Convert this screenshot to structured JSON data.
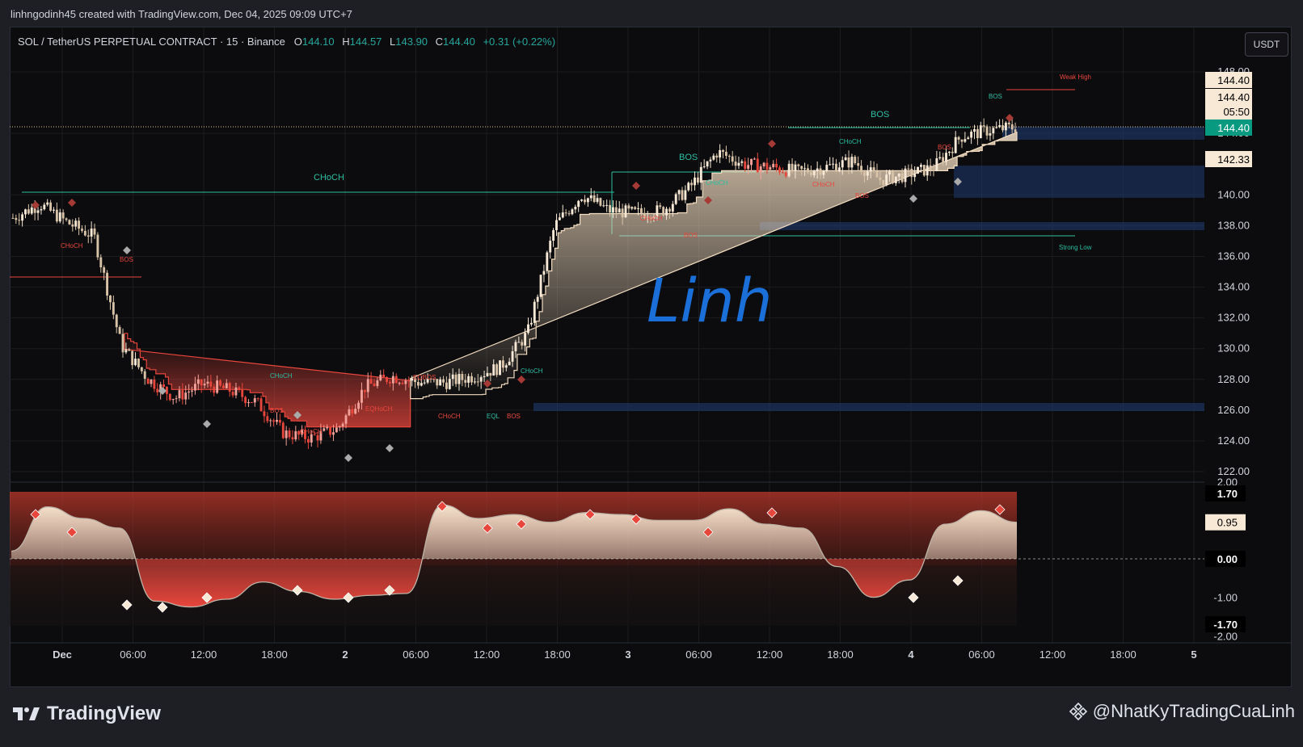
{
  "header": {
    "created_by": "linhngodinh45 created with TradingView.com, Dec 04, 2025 09:09 UTC+7"
  },
  "legend": {
    "symbol": "SOL / TetherUS PERPETUAL CONTRACT · 15 · Binance",
    "o_label": "O",
    "o": "144.10",
    "h_label": "H",
    "h": "144.57",
    "l_label": "L",
    "l": "143.90",
    "c_label": "C",
    "c": "144.40",
    "change": "+0.31 (+0.22%)"
  },
  "currency_button": "USDT",
  "price_axis": {
    "ticks": [
      "148.00",
      "144.00",
      "140.00",
      "138.00",
      "136.00",
      "134.00",
      "132.00",
      "130.00",
      "128.00",
      "126.00",
      "124.00",
      "122.00"
    ],
    "tags": [
      {
        "text": "144.40",
        "kind": "light"
      },
      {
        "text": "144.40",
        "kind": "light"
      },
      {
        "text": "05:50",
        "kind": "light"
      },
      {
        "text": "144.40",
        "kind": "green"
      },
      {
        "text": "142.33",
        "kind": "light"
      }
    ]
  },
  "osc_axis": {
    "ticks": [
      "2.00",
      "1.70",
      "0.95",
      "0.00",
      "-1.00",
      "-1.70",
      "-2.00"
    ]
  },
  "time_axis": {
    "labels": [
      "Dec",
      "06:00",
      "12:00",
      "18:00",
      "2",
      "06:00",
      "12:00",
      "18:00",
      "3",
      "06:00",
      "12:00",
      "18:00",
      "4",
      "06:00",
      "12:00",
      "18:00",
      "5"
    ]
  },
  "annotations": {
    "choch_big": "CHoCH",
    "bos_labels": [
      "BOS",
      "BOS"
    ],
    "choch": "CHoCH",
    "bos": "BOS",
    "eqbos": "EQBOS",
    "eqh_choch": "EQHoCH",
    "eql": "EQL",
    "weak_high": "Weak High",
    "strong_low": "Strong Low",
    "signature": "Linh"
  },
  "chart_data": {
    "type": "line",
    "title": "",
    "xlabel": "",
    "ylabel": "",
    "ylim": [
      122,
      148
    ],
    "x": [
      "Dec 1 00:00",
      "Dec 1 02:00",
      "Dec 1 04:00",
      "Dec 1 06:00",
      "Dec 1 08:00",
      "Dec 1 10:00",
      "Dec 1 12:00",
      "Dec 1 14:00",
      "Dec 1 16:00",
      "Dec 1 18:00",
      "Dec 1 20:00",
      "Dec 1 22:00",
      "Dec 2 00:00",
      "Dec 2 02:00",
      "Dec 2 04:00",
      "Dec 2 06:00",
      "Dec 2 08:00",
      "Dec 2 10:00",
      "Dec 2 12:00",
      "Dec 2 14:00",
      "Dec 2 16:00",
      "Dec 2 18:00",
      "Dec 2 20:00",
      "Dec 2 22:00",
      "Dec 3 00:00",
      "Dec 3 02:00",
      "Dec 3 04:00",
      "Dec 3 06:00",
      "Dec 3 08:00",
      "Dec 3 10:00",
      "Dec 3 12:00",
      "Dec 3 14:00",
      "Dec 3 16:00",
      "Dec 3 18:00",
      "Dec 3 20:00",
      "Dec 3 22:00",
      "Dec 4 00:00",
      "Dec 4 02:00",
      "Dec 4 04:00",
      "Dec 4 06:00",
      "Dec 4 08:00"
    ],
    "series": [
      {
        "name": "SOL",
        "values": [
          138.5,
          139.4,
          138.2,
          137.3,
          130.2,
          128.0,
          126.8,
          127.7,
          127.3,
          126.5,
          124.5,
          124.2,
          124.8,
          127.5,
          128.2,
          127.8,
          127.8,
          128.2,
          128.8,
          131.0,
          138.0,
          140.0,
          139.0,
          138.8,
          139.0,
          140.5,
          142.8,
          142.0,
          141.8,
          141.5,
          141.8,
          142.2,
          141.0,
          141.3,
          141.8,
          143.8,
          144.2,
          144.4
        ]
      }
    ],
    "oscillator": {
      "ylim": [
        -2,
        2
      ],
      "reference_lines": [
        1.7,
        0,
        -1.7
      ],
      "current": 0.95,
      "values": [
        0.2,
        1.35,
        1.05,
        0.8,
        -1.1,
        -1.25,
        -1.05,
        -0.6,
        -0.85,
        -1.05,
        -0.95,
        -0.9,
        1.4,
        1.05,
        1.15,
        0.95,
        1.2,
        1.15,
        1.0,
        1.0,
        1.3,
        0.9,
        0.8,
        -0.2,
        -1.0,
        -0.55,
        0.9,
        1.25,
        0.95
      ]
    }
  }
}
